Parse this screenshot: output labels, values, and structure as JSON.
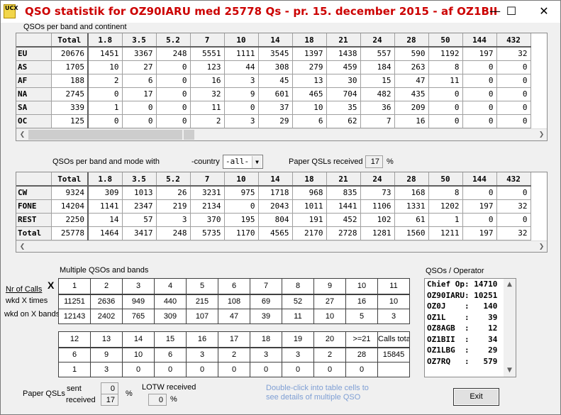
{
  "window": {
    "title": "QSO statistik for OZ90IARU med 25778 Qs -  pr. 15. december 2015 - af OZ1BII",
    "icon_text": "UCX",
    "controls": {
      "minimize": "—",
      "maximize": "☐",
      "close": "✕"
    }
  },
  "continent_section": {
    "label": "QSOs per band and continent",
    "columns": [
      "Total",
      "1.8",
      "3.5",
      "5.2",
      "7",
      "10",
      "14",
      "18",
      "21",
      "24",
      "28",
      "50",
      "144",
      "432"
    ],
    "rows": [
      {
        "name": "EU",
        "values": [
          "20676",
          "1451",
          "3367",
          "248",
          "5551",
          "1111",
          "3545",
          "1397",
          "1438",
          "557",
          "590",
          "1192",
          "197",
          "32"
        ]
      },
      {
        "name": "AS",
        "values": [
          "1705",
          "10",
          "27",
          "0",
          "123",
          "44",
          "308",
          "279",
          "459",
          "184",
          "263",
          "8",
          "0",
          "0"
        ]
      },
      {
        "name": "AF",
        "values": [
          "188",
          "2",
          "6",
          "0",
          "16",
          "3",
          "45",
          "13",
          "30",
          "15",
          "47",
          "11",
          "0",
          "0"
        ]
      },
      {
        "name": "NA",
        "values": [
          "2745",
          "0",
          "17",
          "0",
          "32",
          "9",
          "601",
          "465",
          "704",
          "482",
          "435",
          "0",
          "0",
          "0"
        ]
      },
      {
        "name": "SA",
        "values": [
          "339",
          "1",
          "0",
          "0",
          "11",
          "0",
          "37",
          "10",
          "35",
          "36",
          "209",
          "0",
          "0",
          "0"
        ]
      },
      {
        "name": "OC",
        "values": [
          "125",
          "0",
          "0",
          "0",
          "2",
          "3",
          "29",
          "6",
          "62",
          "7",
          "16",
          "0",
          "0",
          "0"
        ]
      }
    ]
  },
  "mode_section": {
    "label": "QSOs per band and mode with",
    "country_label": "-country",
    "country_selected": "-all-",
    "paper_qsl_label": "Paper QSLs received",
    "paper_qsl_value": "17",
    "percent": "%",
    "columns": [
      "Total",
      "1.8",
      "3.5",
      "5.2",
      "7",
      "10",
      "14",
      "18",
      "21",
      "24",
      "28",
      "50",
      "144",
      "432"
    ],
    "rows": [
      {
        "name": "CW",
        "values": [
          "9324",
          "309",
          "1013",
          "26",
          "3231",
          "975",
          "1718",
          "968",
          "835",
          "73",
          "168",
          "8",
          "0",
          "0"
        ]
      },
      {
        "name": "FONE",
        "values": [
          "14204",
          "1141",
          "2347",
          "219",
          "2134",
          "0",
          "2043",
          "1011",
          "1441",
          "1106",
          "1331",
          "1202",
          "197",
          "32"
        ]
      },
      {
        "name": "REST",
        "values": [
          "2250",
          "14",
          "57",
          "3",
          "370",
          "195",
          "804",
          "191",
          "452",
          "102",
          "61",
          "1",
          "0",
          "0"
        ]
      },
      {
        "name": "Total",
        "values": [
          "25778",
          "1464",
          "3417",
          "248",
          "5735",
          "1170",
          "4565",
          "2170",
          "2728",
          "1281",
          "1560",
          "1211",
          "197",
          "32"
        ]
      }
    ]
  },
  "multiple_section": {
    "label": "Multiple QSOs and bands",
    "nr_of_calls": "Nr of Calls",
    "x_mark": "X",
    "wkd_x_times": "wkd X times",
    "wkd_on_x_bands": "wkd on X bands",
    "table1": {
      "headers": [
        "1",
        "2",
        "3",
        "4",
        "5",
        "6",
        "7",
        "8",
        "9",
        "10",
        "11"
      ],
      "times": [
        "11251",
        "2636",
        "949",
        "440",
        "215",
        "108",
        "69",
        "52",
        "27",
        "16",
        "10"
      ],
      "bands": [
        "12143",
        "2402",
        "765",
        "309",
        "107",
        "47",
        "39",
        "11",
        "10",
        "5",
        "3"
      ]
    },
    "table2": {
      "headers": [
        "12",
        "13",
        "14",
        "15",
        "16",
        "17",
        "18",
        "19",
        "20",
        ">=21",
        "Calls total"
      ],
      "times": [
        "6",
        "9",
        "10",
        "6",
        "3",
        "2",
        "3",
        "3",
        "2",
        "28",
        "15845"
      ],
      "bands": [
        "1",
        "3",
        "0",
        "0",
        "0",
        "0",
        "0",
        "0",
        "0",
        "0",
        ""
      ]
    }
  },
  "operators": {
    "label": "QSOs / Operator",
    "items": [
      "Chief Op: 14710",
      "OZ90IARU: 10251",
      "OZ0J    :   140",
      "OZ1L    :    39",
      "OZ8AGB  :    12",
      "OZ1BII  :    34",
      "OZ1LBG  :    29",
      "OZ7RQ   :   579"
    ]
  },
  "footer": {
    "paper_qsls": "Paper QSLs",
    "sent_label": "sent",
    "sent_value": "0",
    "received_label": "received",
    "received_value": "17",
    "percent": "%",
    "lotw_label": "LOTW received",
    "lotw_value": "0",
    "hint": "Double-click into table cells to see details of multiple QSO",
    "exit_label": "Exit"
  }
}
